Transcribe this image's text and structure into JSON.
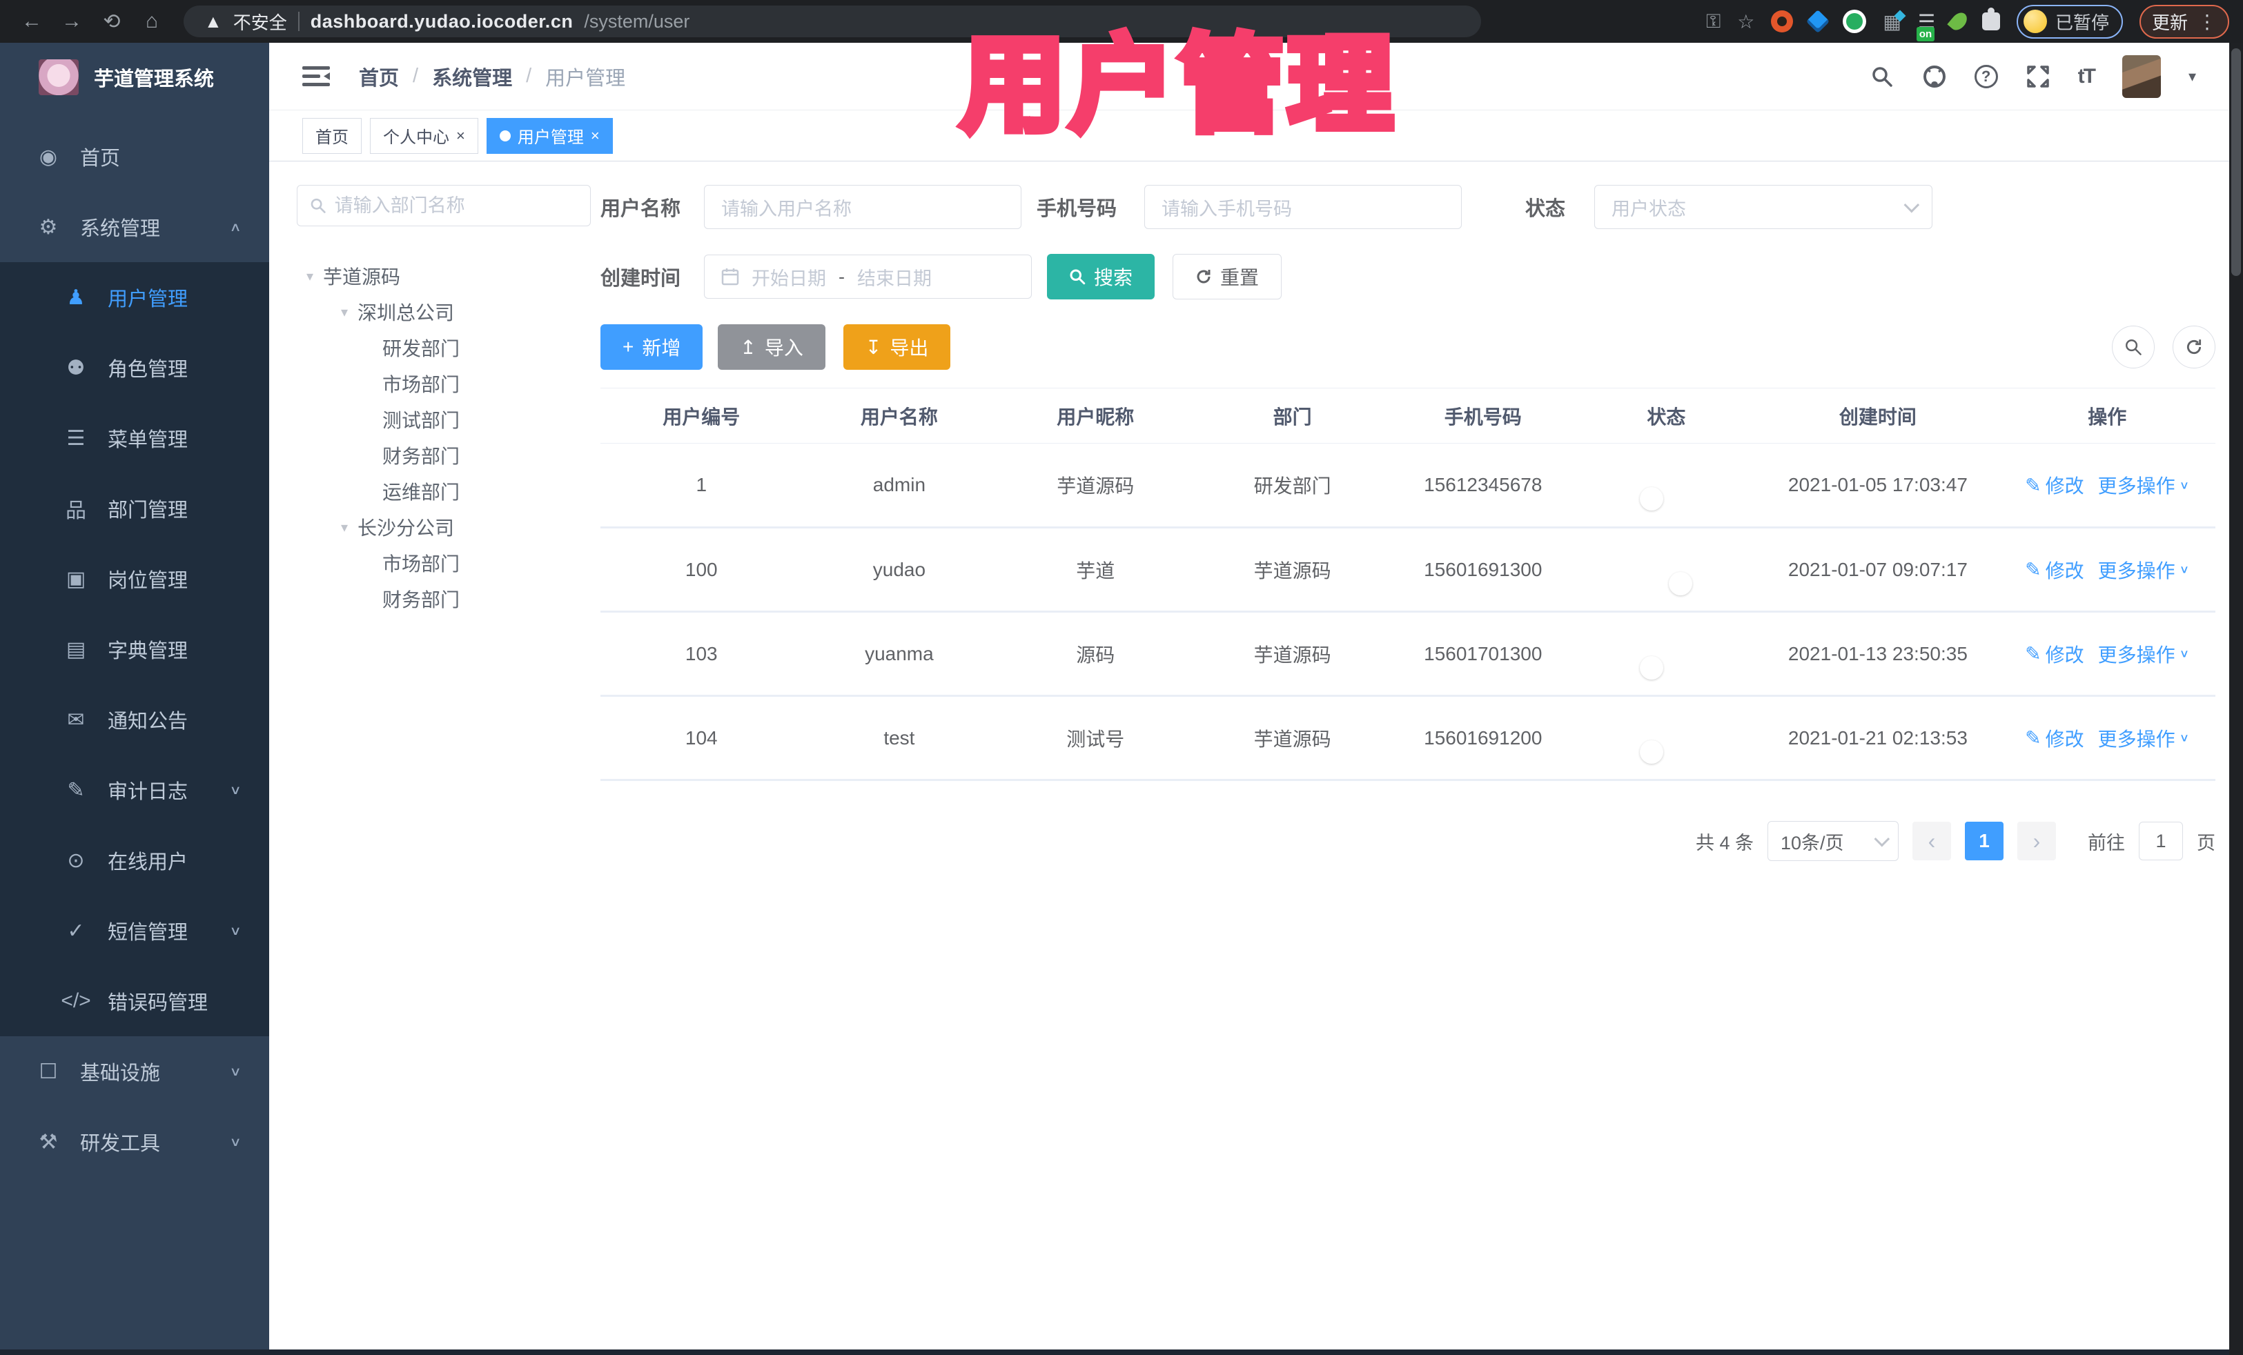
{
  "browser": {
    "security_label": "不安全",
    "url_host": "dashboard.yudao.iocoder.cn",
    "url_path": "/system/user",
    "ext_on_badge": "on",
    "profile_status": "已暂停",
    "update_label": "更新"
  },
  "overlay_title": "用户管理",
  "sidebar": {
    "app_title": "芋道管理系统",
    "menu": [
      {
        "label": "首页",
        "icon": "home-icon",
        "glyph": "◉",
        "cls": "top"
      },
      {
        "label": "系统管理",
        "icon": "gear-icon",
        "glyph": "⚙",
        "cls": "top",
        "caret": "∧"
      },
      {
        "label": "用户管理",
        "icon": "user-icon",
        "glyph": "♟",
        "cls": "sub active"
      },
      {
        "label": "角色管理",
        "icon": "roles-icon",
        "glyph": "⚉",
        "cls": "sub"
      },
      {
        "label": "菜单管理",
        "icon": "menu-list-icon",
        "glyph": "☰",
        "cls": "sub"
      },
      {
        "label": "部门管理",
        "icon": "dept-tree-icon",
        "glyph": "品",
        "cls": "sub"
      },
      {
        "label": "岗位管理",
        "icon": "post-icon",
        "glyph": "▣",
        "cls": "sub"
      },
      {
        "label": "字典管理",
        "icon": "dict-icon",
        "glyph": "▤",
        "cls": "sub"
      },
      {
        "label": "通知公告",
        "icon": "notice-icon",
        "glyph": "✉",
        "cls": "sub"
      },
      {
        "label": "审计日志",
        "icon": "audit-log-icon",
        "glyph": "✎",
        "cls": "sub",
        "caret": "∨"
      },
      {
        "label": "在线用户",
        "icon": "online-users-icon",
        "glyph": "⊙",
        "cls": "sub"
      },
      {
        "label": "短信管理",
        "icon": "sms-icon",
        "glyph": "✓",
        "cls": "sub",
        "caret": "∨"
      },
      {
        "label": "错误码管理",
        "icon": "error-code-icon",
        "glyph": "</>",
        "cls": "sub"
      },
      {
        "label": "基础设施",
        "icon": "infrastructure-icon",
        "glyph": "☐",
        "cls": "top",
        "caret": "∨"
      },
      {
        "label": "研发工具",
        "icon": "devtools-icon",
        "glyph": "⚒",
        "cls": "top",
        "caret": "∨"
      }
    ]
  },
  "header": {
    "breadcrumb": [
      "首页",
      "系统管理",
      "用户管理"
    ],
    "separator": "/",
    "font_icon": "tT"
  },
  "tabs": [
    {
      "label": "首页"
    },
    {
      "label": "个人中心",
      "close": "×"
    },
    {
      "label": "用户管理",
      "close": "×",
      "active": true
    }
  ],
  "dept_tree": {
    "search_placeholder": "请输入部门名称",
    "nodes": [
      {
        "label": "芋道源码",
        "cls": "lvl0",
        "caret": "▾"
      },
      {
        "label": "深圳总公司",
        "cls": "lvl1",
        "caret": "▾"
      },
      {
        "label": "研发部门",
        "cls": "lvl2"
      },
      {
        "label": "市场部门",
        "cls": "lvl2"
      },
      {
        "label": "测试部门",
        "cls": "lvl2"
      },
      {
        "label": "财务部门",
        "cls": "lvl2"
      },
      {
        "label": "运维部门",
        "cls": "lvl2"
      },
      {
        "label": "长沙分公司",
        "cls": "lvl1",
        "caret": "▾"
      },
      {
        "label": "市场部门",
        "cls": "lvl2"
      },
      {
        "label": "财务部门",
        "cls": "lvl2"
      }
    ]
  },
  "filters": {
    "username_label": "用户名称",
    "username_placeholder": "请输入用户名称",
    "mobile_label": "手机号码",
    "mobile_placeholder": "请输入手机号码",
    "status_label": "状态",
    "status_placeholder": "用户状态",
    "created_label": "创建时间",
    "date_start_placeholder": "开始日期",
    "date_separator": "-",
    "date_end_placeholder": "结束日期",
    "search_label": "搜索",
    "reset_label": "重置"
  },
  "toolbar": {
    "add_label": "新增",
    "import_label": "导入",
    "export_label": "导出"
  },
  "table": {
    "columns": [
      "用户编号",
      "用户名称",
      "用户昵称",
      "部门",
      "手机号码",
      "状态",
      "创建时间",
      "操作"
    ],
    "actions": {
      "edit": "修改",
      "more": "更多操作"
    },
    "rows": [
      {
        "id": "1",
        "username": "admin",
        "nickname": "芋道源码",
        "dept": "研发部门",
        "mobile": "15612345678",
        "status_on": true,
        "created": "2021-01-05 17:03:47"
      },
      {
        "id": "100",
        "username": "yudao",
        "nickname": "芋道",
        "dept": "芋道源码",
        "mobile": "15601691300",
        "status_on": false,
        "created": "2021-01-07 09:07:17"
      },
      {
        "id": "103",
        "username": "yuanma",
        "nickname": "源码",
        "dept": "芋道源码",
        "mobile": "15601701300",
        "status_on": true,
        "created": "2021-01-13 23:50:35"
      },
      {
        "id": "104",
        "username": "test",
        "nickname": "测试号",
        "dept": "芋道源码",
        "mobile": "15601691200",
        "status_on": true,
        "created": "2021-01-21 02:13:53"
      }
    ]
  },
  "pagination": {
    "total": "共 4 条",
    "page_size": "10条/页",
    "prev": "‹",
    "current": "1",
    "next": "›",
    "goto_label": "前往",
    "goto_value": "1",
    "page_unit": "页"
  },
  "colors": {
    "primary": "#409eff",
    "search_teal": "#2cb5a5",
    "export_yellow": "#efa11a",
    "import_gray": "#909399",
    "toggle_on": "#1890ff",
    "overlay_pink": "#f53e6b",
    "sidebar_bg": "#304156",
    "submenu_bg": "#1f2d3d"
  }
}
